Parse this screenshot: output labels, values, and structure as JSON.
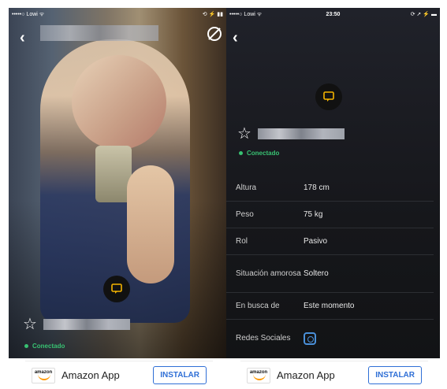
{
  "left": {
    "status": {
      "carrier": "•••••○ Lowi ᯤ",
      "time": "",
      "right": "⟲ ⚡ ▮▮"
    },
    "user": {
      "online_label": "Conectado"
    }
  },
  "right": {
    "status": {
      "carrier": "•••••○ Lowi ᯤ",
      "time": "23:50",
      "right": "⟳ ➚ ⚡ ▬"
    },
    "user": {
      "online_label": "Conectado"
    },
    "profile": [
      {
        "key": "Altura",
        "value": "178 cm"
      },
      {
        "key": "Peso",
        "value": "75 kg"
      },
      {
        "key": "Rol",
        "value": "Pasivo"
      },
      {
        "key": "Situación amorosa",
        "value": "Soltero"
      },
      {
        "key": "En busca de",
        "value": "Este momento"
      },
      {
        "key": "Redes Sociales",
        "value": ""
      }
    ]
  },
  "ads": [
    {
      "brand": "amazon",
      "title": "Amazon App",
      "cta": "INSTALAR"
    },
    {
      "brand": "amazon",
      "title": "Amazon App",
      "cta": "INSTALAR"
    }
  ],
  "colors": {
    "online": "#38c172",
    "chat_icon": "#f5b400",
    "install": "#2f6fd6"
  },
  "icons": {
    "back": "back-chevron-icon",
    "block": "block-icon",
    "chat": "chat-bubble-icon",
    "favorite": "star-outline-icon",
    "instagram": "instagram-icon"
  }
}
